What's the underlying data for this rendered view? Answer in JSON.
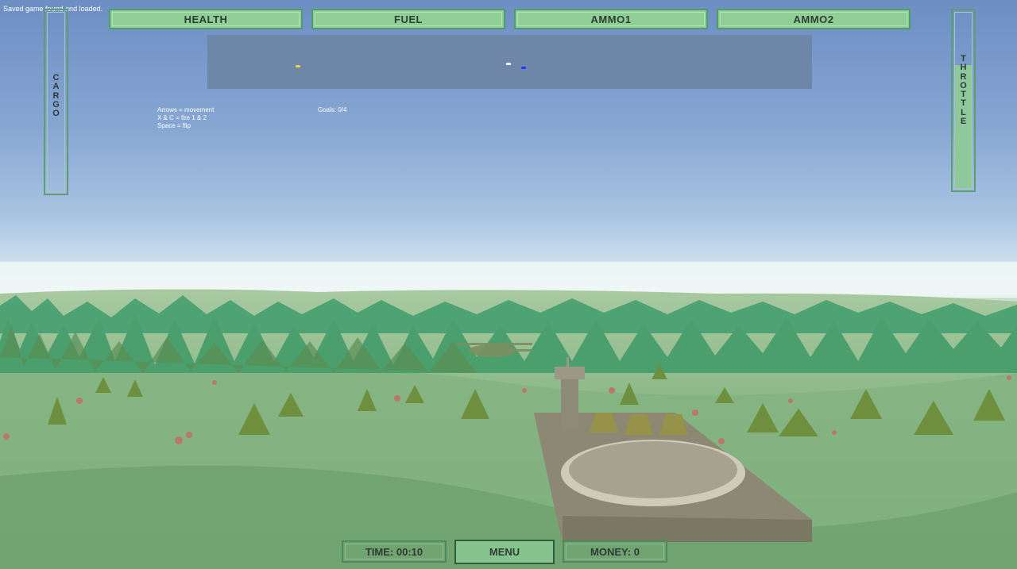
{
  "status_message": "Saved game found and loaded.",
  "hud": {
    "health_label": "HEALTH",
    "fuel_label": "FUEL",
    "ammo1_label": "AMMO1",
    "ammo2_label": "AMMO2",
    "cargo_label": "CARGO",
    "throttle_label": "THROTTLE",
    "throttle_level": 0.7
  },
  "help": {
    "line1": "Arrows = movement",
    "line2": "X & C = fire 1 & 2",
    "line3": "Space = flip"
  },
  "goals_text": "Goals: 0/4",
  "radar_blips": [
    {
      "name": "radar-blip-yellow",
      "color": "#f0d24a"
    },
    {
      "name": "radar-blip-white",
      "color": "#ffffff"
    },
    {
      "name": "radar-blip-blue",
      "color": "#1e3cff"
    }
  ],
  "bottom": {
    "time_text": "TIME: 00:10",
    "menu_label": "MENU",
    "money_text": "MONEY: 0"
  },
  "colors": {
    "hud_green": "#8fcf95",
    "hud_border": "#4f9d68",
    "grass": "#8bb886",
    "tree": "#3f9c6f",
    "base_platform": "#8c8873"
  }
}
